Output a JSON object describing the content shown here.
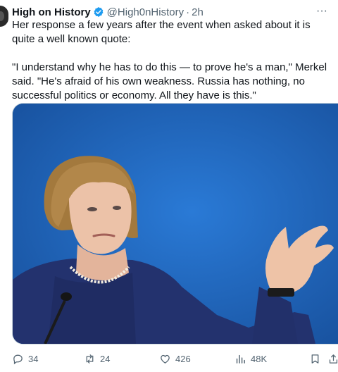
{
  "tweet": {
    "author_name": "High on History",
    "handle": "@High0nHistory",
    "separator": "·",
    "time": "2h",
    "more_label": "···",
    "text_paragraph_1": "Her response a few years after the event when asked about it is quite a well known quote:",
    "text_paragraph_2": "\"I understand why he has to do this — to prove he's a man,\" Merkel said. \"He's afraid of his own weakness. Russia has nothing, no successful politics or economy. All they have is this.\""
  },
  "actions": {
    "replies": "34",
    "retweets": "24",
    "likes": "426",
    "views": "48K"
  },
  "colors": {
    "verified": "#1d9bf0",
    "secondary_text": "#536471",
    "photo_background": "#1e6bc6"
  },
  "icons": [
    "verified-badge-icon",
    "more-icon",
    "reply-icon",
    "retweet-icon",
    "like-icon",
    "views-icon",
    "bookmark-icon",
    "share-icon"
  ]
}
